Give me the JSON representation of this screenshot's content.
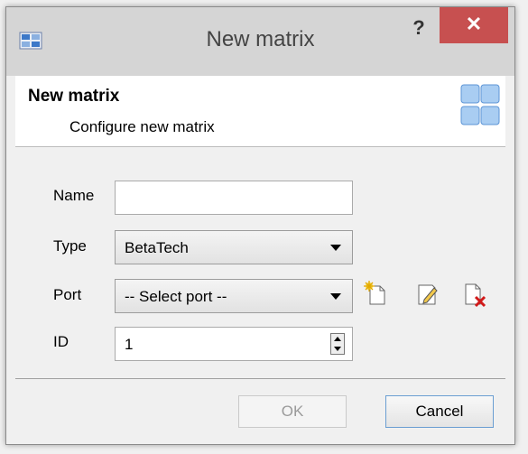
{
  "window": {
    "title": "New matrix",
    "help_glyph": "?",
    "close_glyph": "✕"
  },
  "header": {
    "title": "New matrix",
    "subtitle": "Configure new matrix"
  },
  "form": {
    "name": {
      "label": "Name",
      "value": ""
    },
    "type": {
      "label": "Type",
      "value": "BetaTech"
    },
    "port": {
      "label": "Port",
      "value": "-- Select port --"
    },
    "id": {
      "label": "ID",
      "value": "1"
    }
  },
  "icons": {
    "add_port": "new-document-icon",
    "edit_port": "edit-document-icon",
    "delete_port": "delete-document-icon",
    "matrix": "matrix-grid-icon"
  },
  "buttons": {
    "ok": "OK",
    "cancel": "Cancel"
  },
  "colors": {
    "close_button": "#c75050",
    "titlebar": "#d5d5d5",
    "header_background": "#ffffff",
    "matrix_icon": "#8db8ea"
  }
}
